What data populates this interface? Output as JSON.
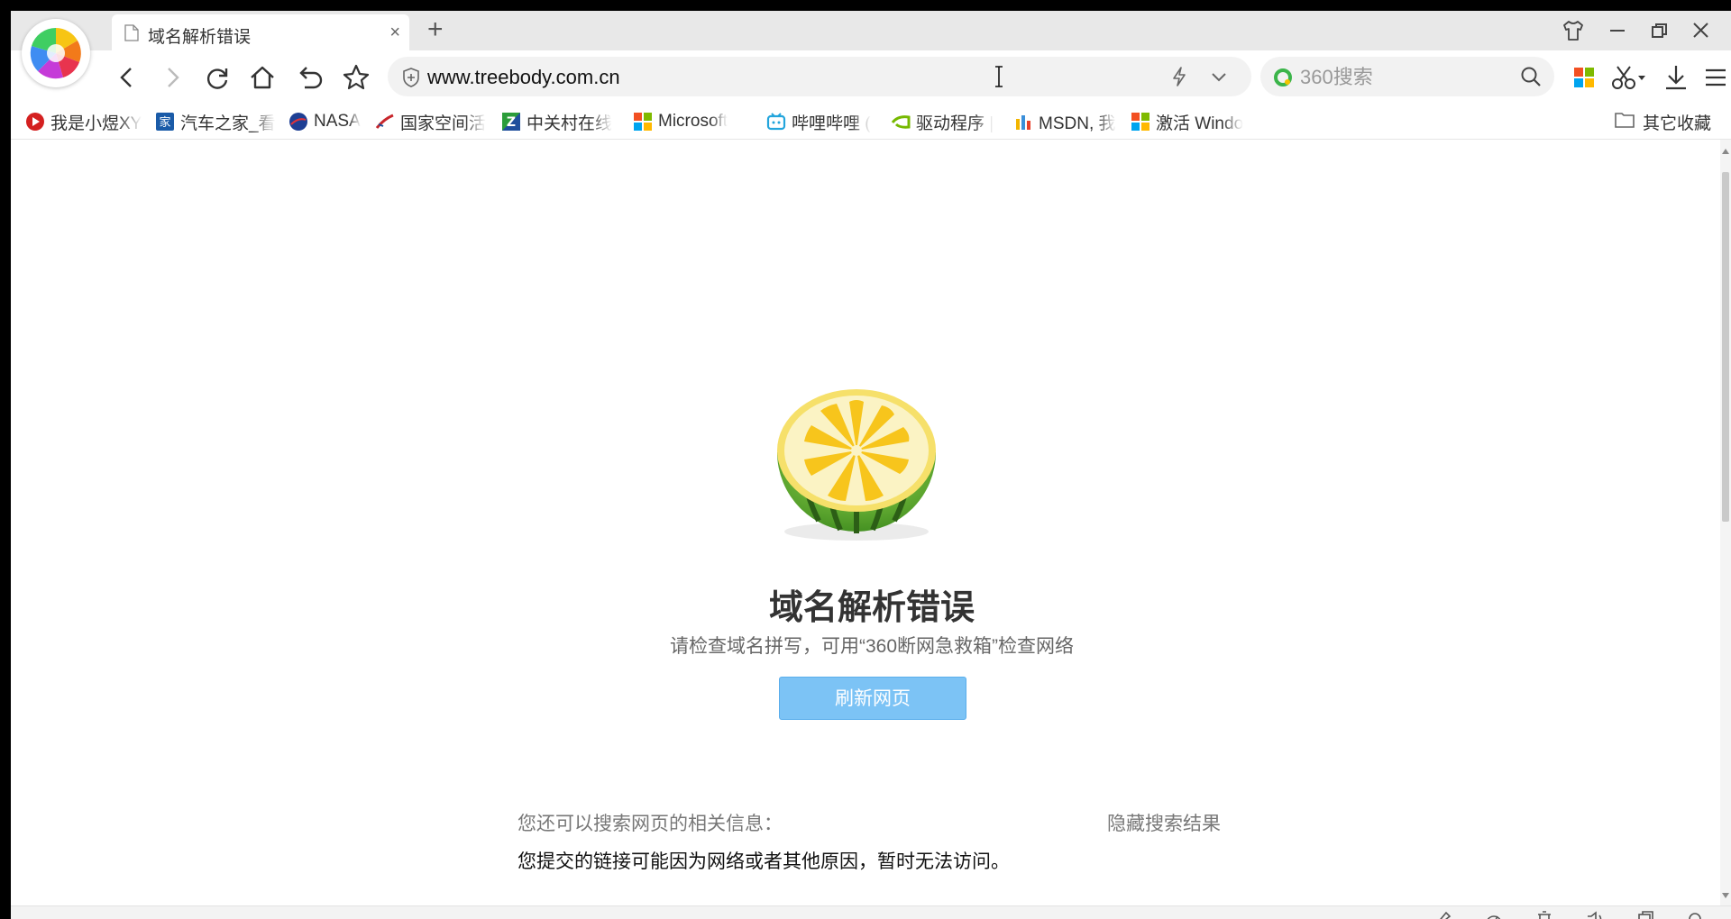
{
  "tab": {
    "title": "域名解析错误",
    "close": "×"
  },
  "new_tab": "+",
  "address": {
    "url": "www.treebody.com.cn"
  },
  "search": {
    "placeholder": "360搜索"
  },
  "bookmarks": [
    {
      "label": "我是小煜XY",
      "icon": "video-play-icon",
      "color": "#d42020"
    },
    {
      "label": "汽车之家_看",
      "icon": "autohome-icon",
      "color": "#1a5ba8"
    },
    {
      "label": "NASA",
      "icon": "nasa-icon",
      "color": "#1e3f94"
    },
    {
      "label": "国家空间活",
      "icon": "space-rocket-icon",
      "color": "#c8262c"
    },
    {
      "label": "中关村在线",
      "icon": "zol-icon",
      "color": "#2b9d3a"
    },
    {
      "label": "Microsoft",
      "icon": "microsoft-icon",
      "color": "#f25022"
    },
    {
      "label": "哔哩哔哩 (",
      "icon": "bilibili-icon",
      "color": "#23a5dc"
    },
    {
      "label": "驱动程序 |",
      "icon": "nvidia-icon",
      "color": "#76b900"
    },
    {
      "label": "MSDN, 我",
      "icon": "msdn-icon",
      "color": "#f2b500"
    },
    {
      "label": "激活 Windo",
      "icon": "windows-icon",
      "color": "#f25022"
    }
  ],
  "other_bookmarks": "其它收藏",
  "error": {
    "title": "域名解析错误",
    "subtitle": "请检查域名拼写，可用“360断网急救箱”检查网络",
    "refresh_button": "刷新网页",
    "related_label": "您还可以搜索网页的相关信息：",
    "hide_results": "隐藏搜索结果",
    "related_text": "您提交的链接可能因为网络或者其他原因，暂时无法访问。"
  },
  "colors": {
    "accent": "#7cc3f5",
    "title": "#333333",
    "muted": "#777777"
  }
}
